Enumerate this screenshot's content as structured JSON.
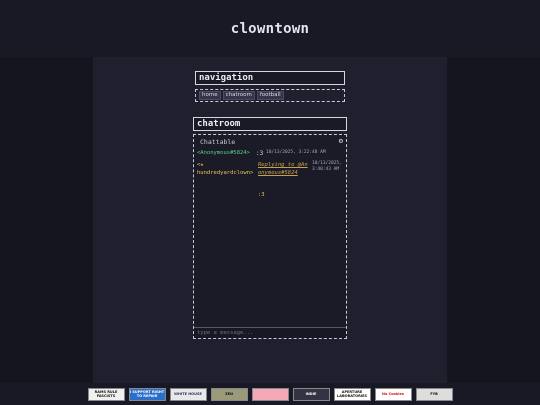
{
  "site": {
    "title": "clowntown"
  },
  "navigation": {
    "title": "navigation",
    "links": [
      "home",
      "chatroom",
      "football"
    ]
  },
  "chatroom": {
    "title": "chatroom",
    "widget_name": "Chattable",
    "settings_icon": "gear-icon",
    "messages": [
      {
        "user": "<Anonymous#5824>",
        "text": ":3",
        "time": "10/13/2025, 3:22:48 AM"
      },
      {
        "user": "<★ hundredyardclown>",
        "reply": "Replying to @Anonymous#5824",
        "text": ":3",
        "time": "10/13/2025, 3:40:43 AM"
      }
    ],
    "input_placeholder": "type a message..."
  },
  "footer": {
    "badges": [
      {
        "label": "RAMS RULE FASCISTS",
        "bg": "#f0f0f0",
        "fg": "#111111"
      },
      {
        "label": "I SUPPORT RIGHT TO REPAIR",
        "bg": "#2a6fc9",
        "fg": "#ffffff"
      },
      {
        "label": "WHITE HOUSE",
        "bg": "#e8e8e8",
        "fg": "#223366"
      },
      {
        "label": "ZEN",
        "bg": "#9a9a7a",
        "fg": "#111111"
      },
      {
        "label": "",
        "bg": "#f5a9b8",
        "fg": "#111111"
      },
      {
        "label": "INDIE",
        "bg": "#333344",
        "fg": "#ffffff"
      },
      {
        "label": "APERTURE LABORATORIES",
        "bg": "#ffffff",
        "fg": "#111111"
      },
      {
        "label": "No Cookies",
        "bg": "#ffffff",
        "fg": "#cc1111"
      },
      {
        "label": "FYB",
        "bg": "#dddddd",
        "fg": "#111111"
      }
    ]
  }
}
